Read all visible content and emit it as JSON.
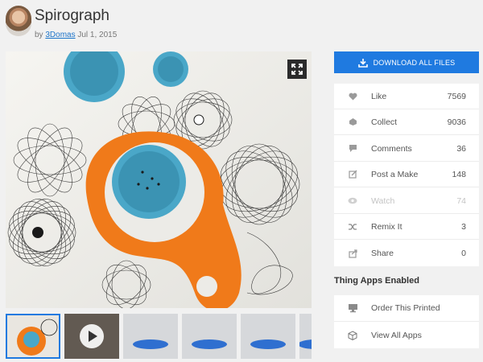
{
  "thing": {
    "title": "Spirograph",
    "by_prefix": "by",
    "author": "3Domas",
    "date": "Jul 1, 2015"
  },
  "download": {
    "label": "DOWNLOAD ALL FILES",
    "icon": "download-icon",
    "color": "#1f7ae0"
  },
  "stats": [
    {
      "label": "Like",
      "value": "7569",
      "icon": "heart-icon"
    },
    {
      "label": "Collect",
      "value": "9036",
      "icon": "collect-icon"
    },
    {
      "label": "Comments",
      "value": "36",
      "icon": "comment-icon"
    },
    {
      "label": "Post a Make",
      "value": "148",
      "icon": "edit-icon"
    },
    {
      "label": "Watch",
      "value": "74",
      "icon": "eye-icon",
      "disabled": true
    },
    {
      "label": "Remix It",
      "value": "3",
      "icon": "shuffle-icon"
    },
    {
      "label": "Share",
      "value": "0",
      "icon": "share-icon"
    }
  ],
  "apps": {
    "heading": "Thing Apps Enabled",
    "items": [
      {
        "label": "Order This Printed",
        "icon": "monitor-icon"
      },
      {
        "label": "View All Apps",
        "icon": "cube-icon"
      }
    ]
  },
  "gallery": {
    "expand_icon": "expand-icon",
    "thumbnails": [
      "photo",
      "video",
      "render",
      "render",
      "render",
      "render"
    ]
  }
}
